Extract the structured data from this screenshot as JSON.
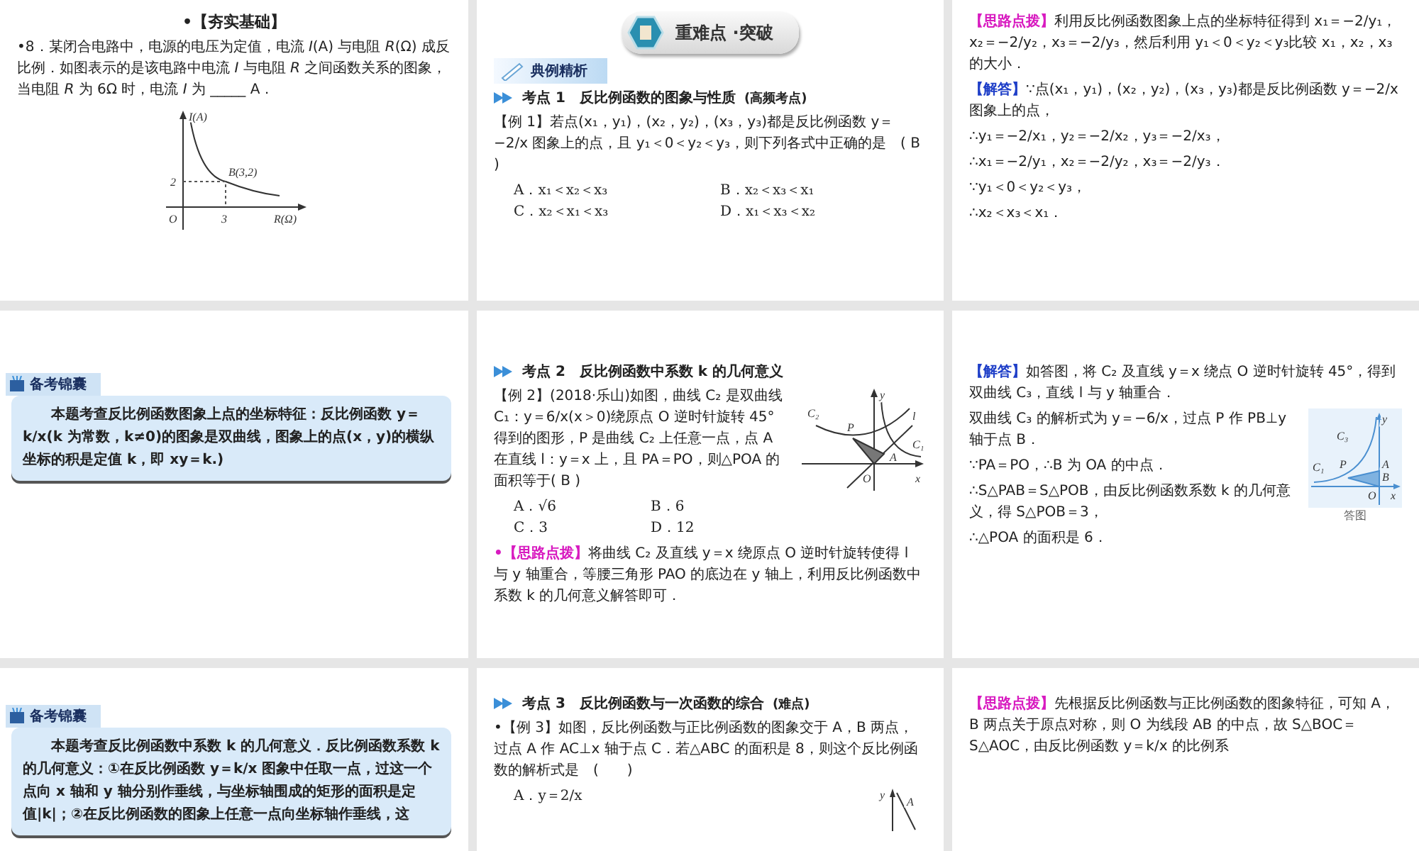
{
  "slides": [
    {
      "blocks": [
        {
          "kind": "title",
          "text": "•【夯实基础】"
        },
        {
          "kind": "text",
          "text": "•8．某闭合电路中，电源的电压为定值，电流 *I*(A) 与电阻 *R*(Ω) 成反比例．如图表示的是该电路中电流 *I* 与电阻 *R* 之间函数关系的图象，当电阻 *R* 为 6Ω 时，电流 *I* 为 _____ A．"
        },
        {
          "kind": "inverse_graph",
          "labels": [
            "I(A)",
            "B(3,2)",
            "2",
            "O",
            "3",
            "R(Ω)"
          ]
        }
      ]
    },
    {
      "blocks": [
        {
          "kind": "banner",
          "text": "重难点 ·突破"
        },
        {
          "kind": "tag",
          "text": "典例精析"
        },
        {
          "kind": "heading",
          "text": "考点 1　反比例函数的图象与性质",
          "note": "(高频考点)"
        },
        {
          "kind": "text",
          "text": "【例 1】若点(x₁，y₁)，(x₂，y₂)，(x₃，y₃)都是反比例函数 y＝−2/x 图象上的点，且 y₁＜0＜y₂＜y₃，则下列各式中正确的是　( B )"
        },
        {
          "kind": "options",
          "items": [
            "A．x₁＜x₂＜x₃",
            "B．x₂＜x₃＜x₁",
            "C．x₂＜x₁＜x₃",
            "D．x₁＜x₃＜x₂"
          ]
        }
      ]
    },
    {
      "blocks": [
        {
          "kind": "text",
          "label": "【思路点拨】",
          "color": "#d81bc0",
          "text": "利用反比例函数图象上点的坐标特征得到 x₁＝−2/y₁，x₂＝−2/y₂，x₃＝−2/y₃，然后利用 y₁＜0＜y₂＜y₃比较 x₁，x₂，x₃的大小．"
        },
        {
          "kind": "text",
          "label": "【解答】",
          "color": "#1f3fc8",
          "text": "∵点(x₁，y₁)，(x₂，y₂)，(x₃，y₃)都是反比例函数 y＝−2/x 图象上的点，"
        },
        {
          "kind": "text",
          "text": "∴y₁＝−2/x₁，y₂＝−2/x₂，y₃＝−2/x₃，"
        },
        {
          "kind": "text",
          "text": "∴x₁＝−2/y₁，x₂＝−2/y₂，x₃＝−2/y₃．"
        },
        {
          "kind": "text",
          "text": "∵y₁＜0＜y₂＜y₃，"
        },
        {
          "kind": "text",
          "text": "∴x₂＜x₃＜x₁．"
        }
      ]
    },
    {
      "blocks": [
        {
          "kind": "tip",
          "tag": "备考锦囊",
          "text": "本题考查反比例函数图象上点的坐标特征：反比例函数 y＝k/x(k 为常数，k≠0)的图象是双曲线，图象上的点(x，y)的横纵坐标的积是定值 k，即 xy＝k.)"
        }
      ]
    },
    {
      "blocks": [
        {
          "kind": "heading",
          "text": "考点 2　反比例函数中系数 k 的几何意义"
        },
        {
          "kind": "split",
          "left": [
            {
              "kind": "text",
              "text": "【例 2】(2018·乐山)如图，曲线 C₂ 是双曲线 C₁：y＝6/x(x＞0)绕原点 O 逆时针旋转 45°得到的图形，P 是曲线 C₂ 上任意一点，点 A 在直线 l：y＝x 上，且 PA＝PO，则△POA 的面积等于( B )"
            },
            {
              "kind": "options",
              "items": [
                "A．√6",
                "B．6",
                "C．3",
                "D．12"
              ]
            }
          ],
          "right": [
            {
              "kind": "rotated_graph",
              "labels": [
                "y",
                "C₂",
                "P",
                "l",
                "C₁",
                "O",
                "A",
                "x"
              ]
            }
          ]
        },
        {
          "kind": "text",
          "label": "•【思路点拨】",
          "color": "#d81bc0",
          "text": "将曲线 C₂ 及直线 y＝x 绕原点 O 逆时针旋转使得 l 与 y 轴重合，等腰三角形 PAO 的底边在 y 轴上，利用反比例函数中系数 k 的几何意义解答即可．"
        }
      ]
    },
    {
      "blocks": [
        {
          "kind": "text",
          "label": "【解答】",
          "color": "#1f3fc8",
          "text": "如答图，将 C₂ 及直线 y＝x 绕点 O 逆时针旋转 45°，得到双曲线 C₃，直线 l 与 y 轴重合．"
        },
        {
          "kind": "split",
          "left": [
            {
              "kind": "text",
              "text": "双曲线 C₃ 的解析式为 y＝−6/x，过点 P 作 PB⊥y 轴于点 B．"
            },
            {
              "kind": "text",
              "text": "∵PA＝PO，∴B 为 OA 的中点．"
            },
            {
              "kind": "text",
              "text": "∴S△PAB＝S△POB，由反比例函数系数 k 的几何意义，得 S△POB＝3，"
            },
            {
              "kind": "text",
              "text": "∴△POA 的面积是 6．"
            }
          ],
          "right": [
            {
              "kind": "answer_graph",
              "labels": [
                "y",
                "C₃",
                "C₁",
                "P",
                "A",
                "B",
                "O",
                "x"
              ],
              "caption": "答图"
            }
          ]
        }
      ]
    },
    {
      "blocks": [
        {
          "kind": "tip",
          "tag": "备考锦囊",
          "text": "本题考查反比例函数中系数 k 的几何意义．反比例函数系数 k 的几何意义：①在反比例函数 y＝k/x 图象中任取一点，过这一个点向 x 轴和 y 轴分别作垂线，与坐标轴围成的矩形的面积是定值|k|；②在反比例函数的图象上任意一点向坐标轴作垂线，这"
        }
      ]
    },
    {
      "blocks": [
        {
          "kind": "heading",
          "text": "考点 3　反比例函数与一次函数的综合",
          "note": "(难点)"
        },
        {
          "kind": "text",
          "text": "•【例 3】如图，反比例函数与正比例函数的图象交于 A，B 两点，过点 A 作 AC⊥x 轴于点 C．若△ABC 的面积是 8，则这个反比例函数的解析式是　(　　)"
        },
        {
          "kind": "split",
          "left": [
            {
              "kind": "options",
              "items": [
                "A．y＝2/x"
              ]
            }
          ],
          "right": [
            {
              "kind": "partial_graph",
              "labels": [
                "y",
                "A"
              ]
            }
          ]
        }
      ]
    },
    {
      "blocks": [
        {
          "kind": "text",
          "label": "【思路点拨】",
          "color": "#d81bc0",
          "text": "先根据反比例函数与正比例函数的图象特征，可知 A，B 两点关于原点对称，则 O 为线段 AB 的中点，故 S△BOC＝S△AOC，由反比例函数 y＝k/x 的比例系"
        }
      ]
    }
  ]
}
